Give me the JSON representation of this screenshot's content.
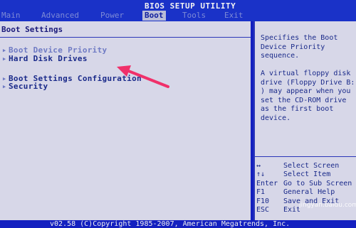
{
  "header": {
    "title": "BIOS SETUP UTILITY",
    "tabs": [
      {
        "label": "Main"
      },
      {
        "label": "Advanced"
      },
      {
        "label": "Power"
      },
      {
        "label": "Boot"
      },
      {
        "label": "Tools"
      },
      {
        "label": "Exit"
      }
    ]
  },
  "main": {
    "heading": "Boot Settings",
    "items": [
      {
        "label": "Boot Device Priority"
      },
      {
        "label": "Hard Disk Drives"
      },
      {
        "label": "Boot Settings Configuration"
      },
      {
        "label": "Security"
      }
    ]
  },
  "side": {
    "help_1": "Specifies the Boot\nDevice Priority\nsequence.",
    "help_2": "A virtual floppy disk\ndrive (Floppy Drive B:\n) may appear when you\nset the CD-ROM drive\nas the first boot\ndevice.",
    "keys": [
      {
        "key": "↔",
        "desc": "Select Screen"
      },
      {
        "key": "↑↓",
        "desc": "Select Item"
      },
      {
        "key": "Enter",
        "desc": "Go to Sub Screen"
      },
      {
        "key": "F1",
        "desc": "General Help"
      },
      {
        "key": "F10",
        "desc": "Save and Exit"
      },
      {
        "key": "ESC",
        "desc": "Exit"
      }
    ]
  },
  "footer": {
    "copyright": "v02.58 (C)Copyright 1985-2007, American Megatrends, Inc.",
    "watermark": "jingyan.baidu.com"
  },
  "colors": {
    "background_blue": "#1420c0",
    "pane_gray": "#d7d7e8",
    "text_navy": "#1a2a8a",
    "arrow_pink": "#f0306a"
  }
}
